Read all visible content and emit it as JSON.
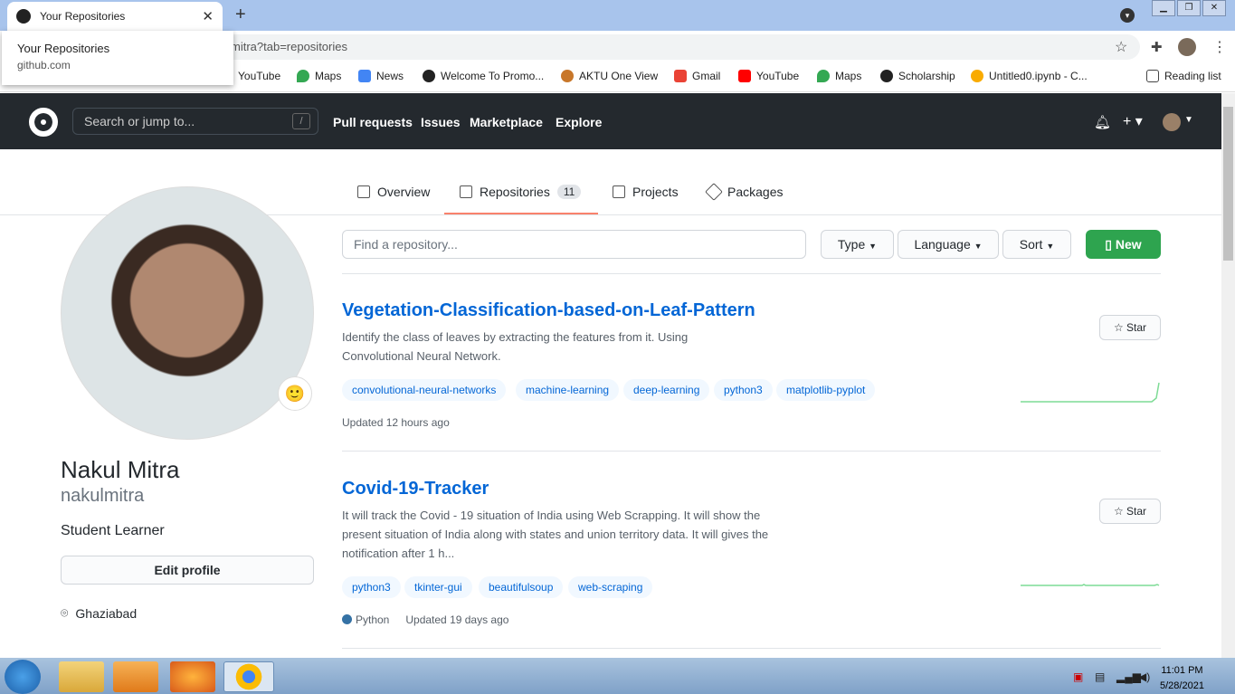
{
  "browser": {
    "tab_title": "Your Repositories",
    "url_suffix": "mitra?tab=repositories",
    "popup_title": "Your Repositories",
    "popup_url": "github.com",
    "bookmarks": [
      "YouTube",
      "Maps",
      "News",
      "Welcome To Promo...",
      "AKTU One View",
      "Gmail",
      "YouTube",
      "Maps",
      "Scholarship",
      "Untitled0.ipynb - C..."
    ],
    "reading_list": "Reading list"
  },
  "github": {
    "search_placeholder": "Search or jump to...",
    "search_key": "/",
    "nav": [
      "Pull requests",
      "Issues",
      "Marketplace",
      "Explore"
    ]
  },
  "profile": {
    "tabs": {
      "overview": "Overview",
      "repositories": "Repositories",
      "repo_count": "11",
      "projects": "Projects",
      "packages": "Packages"
    },
    "name": "Nakul Mitra",
    "username": "nakulmitra",
    "bio": "Student Learner",
    "edit_label": "Edit profile",
    "location": "Ghaziabad"
  },
  "repo_controls": {
    "find_placeholder": "Find a repository...",
    "type": "Type",
    "language": "Language",
    "sort": "Sort",
    "new": "New"
  },
  "repos": [
    {
      "title": "Vegetation-Classification-based-on-Leaf-Pattern",
      "description": "Identify the class of leaves by extracting the features from it. Using Convolutional Neural Network.",
      "topics": [
        "convolutional-neural-networks",
        "machine-learning",
        "deep-learning",
        "python3",
        "matplotlib-pyplot"
      ],
      "updated": "Updated 12 hours ago",
      "star": "Star"
    },
    {
      "title": "Covid-19-Tracker",
      "description": "It will track the Covid - 19 situation of India using Web Scrapping. It will show the present situation of India along with states and union territory data. It will gives the notification after 1 h...",
      "topics": [
        "python3",
        "tkinter-gui",
        "beautifulsoup",
        "web-scraping"
      ],
      "language": "Python",
      "updated": "Updated 19 days ago",
      "star": "Star"
    }
  ],
  "taskbar": {
    "time": "11:01 PM",
    "date": "5/28/2021"
  },
  "colors": {
    "accent_green": "#2ea44f",
    "link_blue": "#0366d6",
    "header_dark": "#24292e",
    "tab_underline": "#f9826c"
  }
}
